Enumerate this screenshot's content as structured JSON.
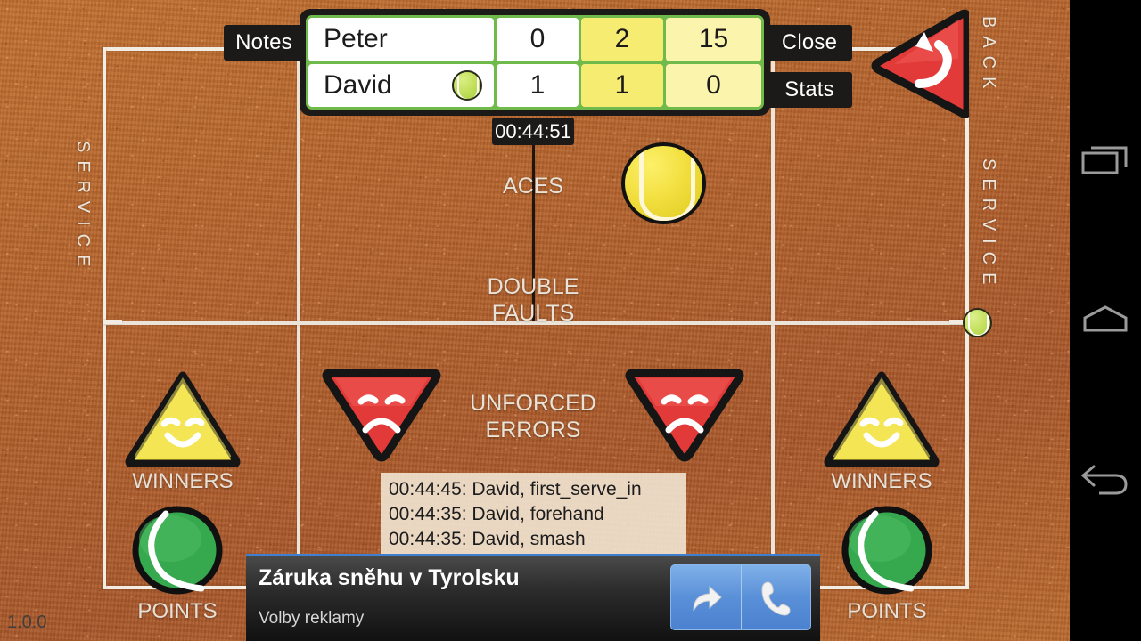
{
  "app": {
    "version": "1.0.0",
    "timer": "00:44:51"
  },
  "buttons": {
    "notes": "Notes",
    "close": "Close",
    "stats": "Stats",
    "undo": "undo-button"
  },
  "scoreboard": {
    "columns": [
      "player",
      "sets",
      "games",
      "points"
    ],
    "rows": [
      {
        "name": "Peter",
        "serving": false,
        "sets": "0",
        "games": "2",
        "points": "15"
      },
      {
        "name": "David",
        "serving": true,
        "sets": "1",
        "games": "1",
        "points": "0"
      }
    ],
    "colors": {
      "frame": "#1c1a18",
      "grid": "#6fba4a",
      "name_cell": "#ffffff",
      "games_cell": "#f6ec72",
      "points_cell": "#fbf4ac"
    }
  },
  "court": {
    "surface_color": "#b4622c",
    "line_color": "#f3ece2",
    "left_label": "SERVICE",
    "right_labels": [
      "BACK",
      "SERVICE"
    ],
    "center_labels": [
      "ACES",
      "DOUBLE\nFAULTS",
      "UNFORCED\nERRORS"
    ]
  },
  "stat_buttons": {
    "left": [
      {
        "label": "WINNERS",
        "icon": "yellow-smile-triangle-icon"
      },
      {
        "label": "POINTS",
        "icon": "green-ball-icon"
      }
    ],
    "center": [
      {
        "label": "",
        "icon": "red-sad-triangle-icon"
      },
      {
        "label": "",
        "icon": "red-sad-triangle-icon"
      }
    ],
    "right": [
      {
        "label": "WINNERS",
        "icon": "yellow-smile-triangle-icon"
      },
      {
        "label": "POINTS",
        "icon": "green-ball-icon"
      }
    ]
  },
  "balls": {
    "big": "yellow-tennis-ball-icon",
    "side": "small-yellow-tennis-ball-icon"
  },
  "log": {
    "entries": [
      "00:44:45: David, first_serve_in",
      "00:44:35: David, forehand",
      "00:44:35: David, smash"
    ]
  },
  "ad": {
    "title": "Záruka sněhu v Tyrolsku",
    "subtitle": "Volby reklamy",
    "action_icons": [
      "share-arrow-icon",
      "phone-icon"
    ],
    "accent": "#3f7fd0"
  },
  "navbar": {
    "items": [
      {
        "name": "recents",
        "icon": "recents-icon"
      },
      {
        "name": "home",
        "icon": "home-icon"
      },
      {
        "name": "back",
        "icon": "back-icon"
      }
    ]
  }
}
